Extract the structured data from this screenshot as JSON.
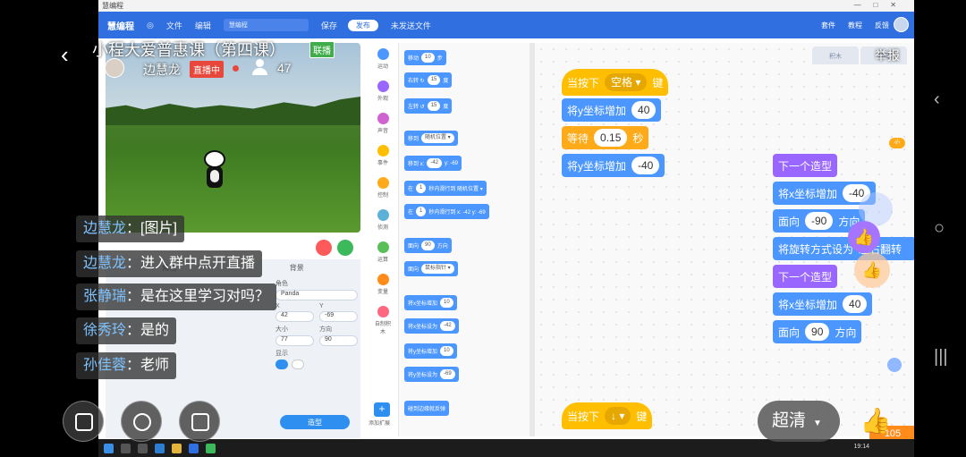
{
  "window": {
    "title": "慧编程"
  },
  "toolbar": {
    "brand": "慧编程",
    "file": "文件",
    "edit": "编辑",
    "project_name": "慧编程",
    "save": "保存",
    "publish": "发布",
    "unsaved": "未发送文件",
    "extensions": "套件",
    "tutorial": "教程",
    "feedback": "反馈"
  },
  "live": {
    "title": "小程大爱普惠课（第四课）",
    "badge": "联播",
    "host": "边慧龙",
    "status": "直播中",
    "viewers": "47",
    "report": "举报",
    "quality": "超清"
  },
  "chat": [
    {
      "name": "边慧龙",
      "sep": "：",
      "msg": "[图片]"
    },
    {
      "name": "边慧龙",
      "sep": "：",
      "msg": "进入群中点开直播"
    },
    {
      "name": "张静瑞",
      "sep": "：",
      "msg": "是在这里学习对吗？"
    },
    {
      "name": "徐秀玲",
      "sep": "：",
      "msg": "是的"
    },
    {
      "name": "孙佳蓉",
      "sep": "：",
      "msg": "老师"
    }
  ],
  "categories": [
    {
      "label": "运动",
      "color": "#4c97ff"
    },
    {
      "label": "外观",
      "color": "#9966ff"
    },
    {
      "label": "声音",
      "color": "#cf63cf"
    },
    {
      "label": "事件",
      "color": "#ffbf00"
    },
    {
      "label": "控制",
      "color": "#ffab19"
    },
    {
      "label": "侦测",
      "color": "#5cb1d6"
    },
    {
      "label": "运算",
      "color": "#59c059"
    },
    {
      "label": "变量",
      "color": "#ff8c1a"
    },
    {
      "label": "自制积木",
      "color": "#ff6680"
    }
  ],
  "add_extension": "添加扩展",
  "palette": [
    {
      "text": "移动",
      "val": "10",
      "tail": "步"
    },
    {
      "text": "右转 ↻",
      "val": "15",
      "tail": "度"
    },
    {
      "text": "左转 ↺",
      "val": "15",
      "tail": "度"
    },
    {
      "text": "移到",
      "val": "随机位置 ▾",
      "tail": ""
    },
    {
      "text": "移到 x:",
      "val": "-42",
      "tail": "y: -69"
    },
    {
      "text": "在",
      "val": "1",
      "tail": "秒内滑行到 随机位置 ▾"
    },
    {
      "text": "在",
      "val": "1",
      "tail": "秒内滑行到 x: -42 y: -69"
    },
    {
      "text": "面向",
      "val": "90",
      "tail": "方向"
    },
    {
      "text": "面向",
      "val": "鼠标指针 ▾",
      "tail": ""
    },
    {
      "text": "将x坐标增加",
      "val": "10",
      "tail": ""
    },
    {
      "text": "将x坐标设为",
      "val": "-42",
      "tail": ""
    },
    {
      "text": "将y坐标增加",
      "val": "10",
      "tail": ""
    },
    {
      "text": "将y坐标设为",
      "val": "-69",
      "tail": ""
    },
    {
      "text": "碰到边缘就反弹",
      "val": "",
      "tail": ""
    }
  ],
  "sprite": {
    "tab_sprite": "角色",
    "tab_bg": "背景",
    "name_label": "角色",
    "name": "Panda",
    "x_label": "X",
    "x": "42",
    "y_label": "Y",
    "y": "-69",
    "size_label": "大小",
    "size": "77",
    "dir_label": "方向",
    "dir": "90",
    "show_label": "显示",
    "costume_btn": "造型"
  },
  "ws_tabs": [
    "积木",
    "源码"
  ],
  "script1": {
    "hat": "当按下",
    "key": "空格 ▾",
    "hat_tail": "键",
    "b1": "将y坐标增加",
    "b1v": "40",
    "b2": "等待",
    "b2v": "0.15",
    "b2t": "秒",
    "b3": "将y坐标增加",
    "b3v": "-40"
  },
  "script2": {
    "l1": "下一个造型",
    "l2": "将x坐标增加",
    "l2v": "-40",
    "l3": "面向",
    "l3v": "-90",
    "l3t": "方向",
    "l4": "将旋转方式设为",
    "l4v": "左右翻转",
    "l5": "下一个造型",
    "l6": "将x坐标增加",
    "l6v": "40",
    "l7": "面向",
    "l7v": "90",
    "l7t": "方向"
  },
  "script3": {
    "hat": "当按下",
    "key": "↓ ▾",
    "hat_tail": "键"
  },
  "counter": "105",
  "clock": "19:14",
  "colors": {
    "accent": "#2f6fe0",
    "event": "#ffbf00",
    "motion": "#4c97ff",
    "looks": "#9966ff",
    "control": "#ffab19"
  }
}
